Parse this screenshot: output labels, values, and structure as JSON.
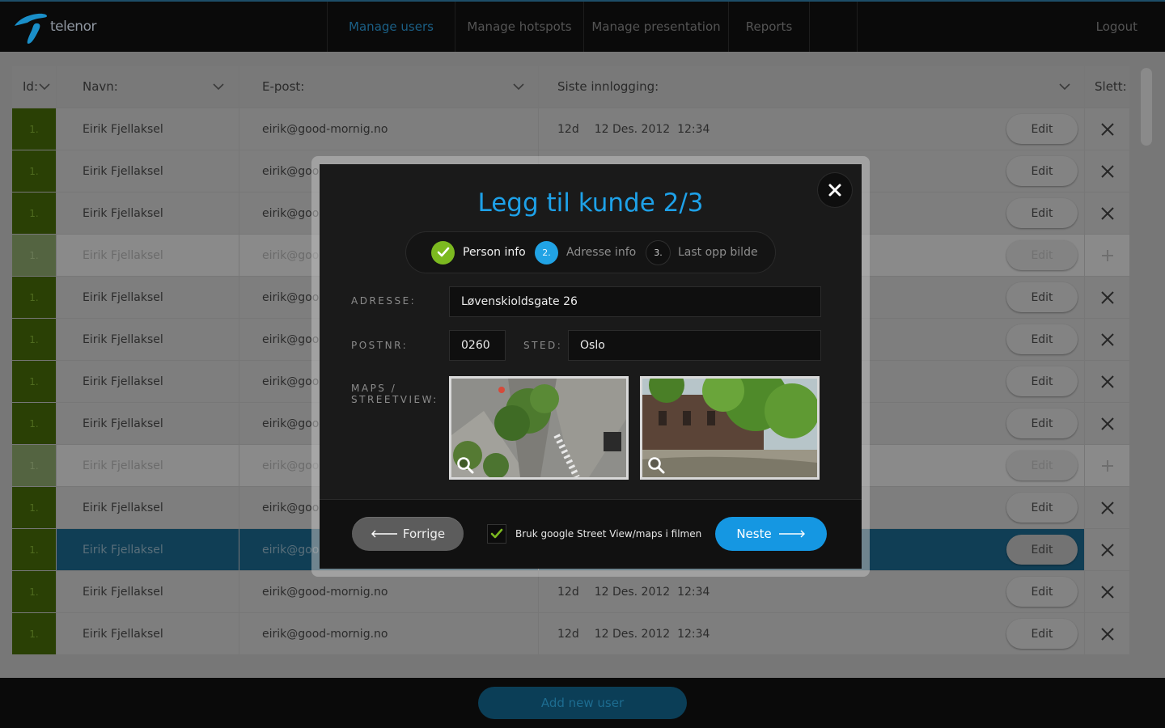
{
  "app": {
    "logo_text": "telenor",
    "nav": [
      "Manage users",
      "Manage hotspots",
      "Manage presentation",
      "Reports"
    ],
    "logout": "Logout"
  },
  "table": {
    "headers": {
      "id": "Id:",
      "name": "Navn:",
      "email": "E-post:",
      "last_login": "Siste innlogging:",
      "delete": "Slett:"
    },
    "edit_label": "Edit",
    "rows": [
      {
        "id": "1.",
        "name": "Eirik Fjellaksel",
        "email": "eirik@good-mornig.no",
        "days": "12d",
        "date": "12 Des. 2012  12:34",
        "state": "normal",
        "action": "delete"
      },
      {
        "id": "1.",
        "name": "Eirik Fjellaksel",
        "email": "eirik@goo",
        "days": "",
        "date": "",
        "state": "normal",
        "action": "delete"
      },
      {
        "id": "1.",
        "name": "Eirik Fjellaksel",
        "email": "eirik@goo",
        "days": "",
        "date": "",
        "state": "normal",
        "action": "delete"
      },
      {
        "id": "1.",
        "name": "Eirik Fjellaksel",
        "email": "eirik@goo",
        "days": "",
        "date": "",
        "state": "faded",
        "action": "add"
      },
      {
        "id": "1.",
        "name": "Eirik Fjellaksel",
        "email": "eirik@goo",
        "days": "",
        "date": "",
        "state": "normal",
        "action": "delete"
      },
      {
        "id": "1.",
        "name": "Eirik Fjellaksel",
        "email": "eirik@goo",
        "days": "",
        "date": "",
        "state": "normal",
        "action": "delete"
      },
      {
        "id": "1.",
        "name": "Eirik Fjellaksel",
        "email": "eirik@goo",
        "days": "",
        "date": "",
        "state": "normal",
        "action": "delete"
      },
      {
        "id": "1.",
        "name": "Eirik Fjellaksel",
        "email": "eirik@goo",
        "days": "",
        "date": "",
        "state": "normal",
        "action": "delete"
      },
      {
        "id": "1.",
        "name": "Eirik Fjellaksel",
        "email": "eirik@goo",
        "days": "",
        "date": "",
        "state": "faded",
        "action": "add"
      },
      {
        "id": "1.",
        "name": "Eirik Fjellaksel",
        "email": "eirik@goo",
        "days": "",
        "date": "",
        "state": "normal",
        "action": "delete"
      },
      {
        "id": "1.",
        "name": "Eirik Fjellaksel",
        "email": "eirik@goo",
        "days": "",
        "date": "",
        "state": "selected",
        "action": "delete"
      },
      {
        "id": "1.",
        "name": "Eirik Fjellaksel",
        "email": "eirik@good-mornig.no",
        "days": "12d",
        "date": "12 Des. 2012  12:34",
        "state": "normal",
        "action": "delete"
      },
      {
        "id": "1.",
        "name": "Eirik Fjellaksel",
        "email": "eirik@good-mornig.no",
        "days": "12d",
        "date": "12 Des. 2012  12:34",
        "state": "normal",
        "action": "delete"
      }
    ]
  },
  "add_user": "Add new user",
  "modal": {
    "title": "Legg til kunde 2/3",
    "steps": [
      {
        "number": "",
        "label": "Person info",
        "status": "done"
      },
      {
        "number": "2.",
        "label": "Adresse info",
        "status": "active"
      },
      {
        "number": "3.",
        "label": "Last opp bilde",
        "status": "pending"
      }
    ],
    "address_label": "ADRESSE:",
    "address_value": "Løvenskioldsgate 26",
    "postnr_label": "POSTNR:",
    "postnr_value": "0260",
    "sted_label": "STED:",
    "sted_value": "Oslo",
    "maps_label_line1": "MAPS /",
    "maps_label_line2": "STREETVIEW:",
    "checkbox_label": "Bruk google Street View/maps i filmen",
    "checkbox_checked": true,
    "prev_label": "Forrige",
    "next_label": "Neste"
  },
  "colors": {
    "accent_blue": "#1ea1e8",
    "check_green": "#7cb920",
    "id_green": "#2a4005",
    "selected_row": "#103e55"
  }
}
